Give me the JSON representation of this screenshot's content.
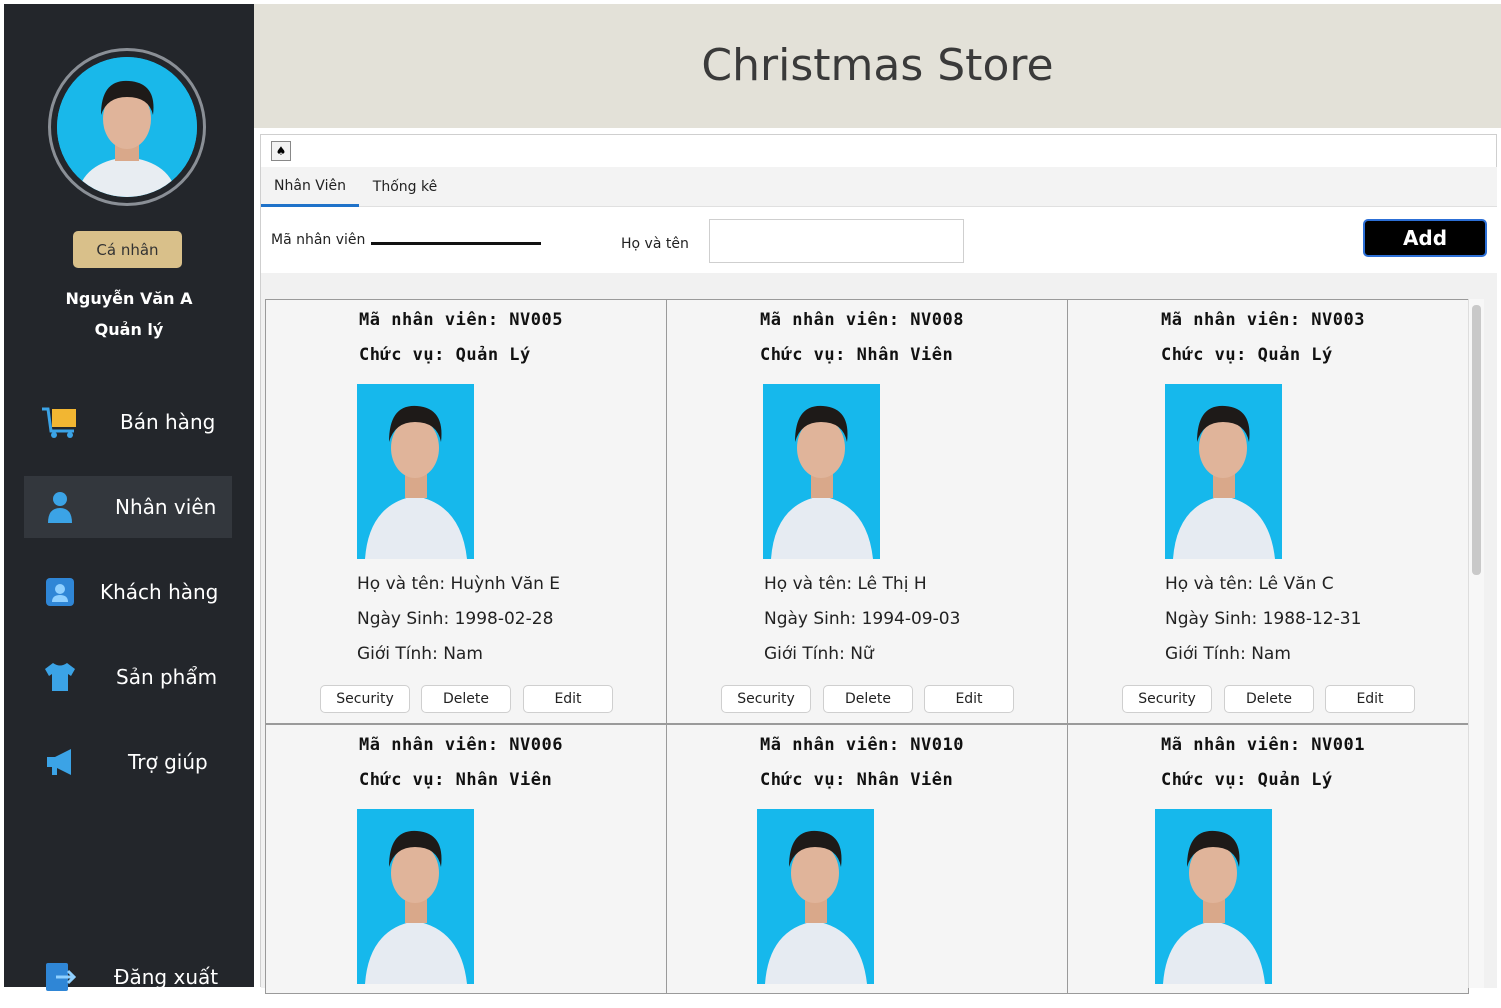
{
  "sidebar": {
    "profile_button": "Cá nhân",
    "user_name": "Nguyễn Văn A",
    "user_role": "Quản lý",
    "items": [
      {
        "label": "Bán hàng",
        "icon": "cart-icon"
      },
      {
        "label": "Nhân viên",
        "icon": "person-icon"
      },
      {
        "label": "Khách hàng",
        "icon": "contacts-icon"
      },
      {
        "label": "Sản phẩm",
        "icon": "shirt-icon"
      },
      {
        "label": "Trợ giúp",
        "icon": "megaphone-icon"
      },
      {
        "label": "Đăng xuất",
        "icon": "logout-icon"
      }
    ],
    "active_item": "Nhân viên"
  },
  "header": {
    "title": "Christmas Store"
  },
  "tabs": [
    {
      "label": "Nhân Viên",
      "active": true
    },
    {
      "label": "Thống kê",
      "active": false
    }
  ],
  "filters": {
    "employee_id_label": "Mã nhân viên",
    "employee_id_value": "",
    "full_name_label": "Họ và tên",
    "full_name_value": "",
    "add_label": "Add"
  },
  "employees": [
    {
      "code": "Mã nhân viên: NV005",
      "role": "Chức vụ: Quản Lý",
      "name": "Họ và tên: Huỳnh Văn E",
      "dob": "Ngày Sinh: 1998-02-28",
      "gender": "Giới Tính: Nam"
    },
    {
      "code": "Mã nhân viên: NV008",
      "role": "Chức vụ: Nhân Viên",
      "name": "Họ và tên: Lê Thị H",
      "dob": "Ngày Sinh: 1994-09-03",
      "gender": "Giới Tính: Nữ"
    },
    {
      "code": "Mã nhân viên: NV003",
      "role": "Chức vụ: Quản Lý",
      "name": "Họ và tên: Lê Văn C",
      "dob": "Ngày Sinh: 1988-12-31",
      "gender": "Giới Tính: Nam"
    },
    {
      "code": "Mã nhân viên: NV006",
      "role": "Chức vụ: Nhân Viên"
    },
    {
      "code": "Mã nhân viên: NV010",
      "role": "Chức vụ: Nhân Viên"
    },
    {
      "code": "Mã nhân viên: NV001",
      "role": "Chức vụ: Quản Lý"
    }
  ],
  "card_buttons": {
    "security": "Security",
    "delete": "Delete",
    "edit": "Edit"
  },
  "colors": {
    "sidebar_bg": "#23262b",
    "header_bg": "#e3e1d8",
    "accent_button": "#d9c08a",
    "photo_bg": "#16b8ec",
    "tab_active": "#1f72c9"
  }
}
